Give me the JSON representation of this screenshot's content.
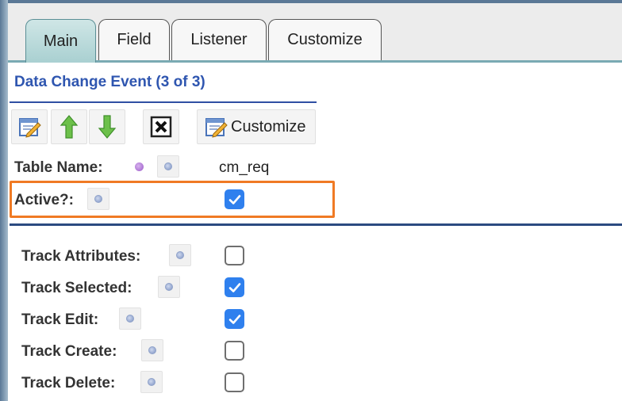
{
  "tabs": [
    {
      "label": "Main",
      "active": true
    },
    {
      "label": "Field",
      "active": false
    },
    {
      "label": "Listener",
      "active": false
    },
    {
      "label": "Customize",
      "active": false
    }
  ],
  "section": {
    "title": "Data Change Event (3 of 3)"
  },
  "toolbar": {
    "edit_icon": "edit-icon",
    "up_icon": "arrow-up-icon",
    "down_icon": "arrow-down-icon",
    "delete_icon": "delete-icon",
    "customize_label": "Customize"
  },
  "fields": {
    "table_name": {
      "label": "Table Name:",
      "value": "cm_req",
      "mandatory": true
    },
    "active": {
      "label": "Active?:",
      "checked": true
    }
  },
  "tracking": [
    {
      "label": "Track Attributes:",
      "checked": false
    },
    {
      "label": "Track Selected:",
      "checked": true
    },
    {
      "label": "Track Edit:",
      "checked": true
    },
    {
      "label": "Track Create:",
      "checked": false
    },
    {
      "label": "Track Delete:",
      "checked": false
    }
  ],
  "colors": {
    "title": "#2f56b0",
    "active_tab": "#a9d0d1",
    "highlight": "#f07a24",
    "checkbox_on": "#2f80ee"
  }
}
